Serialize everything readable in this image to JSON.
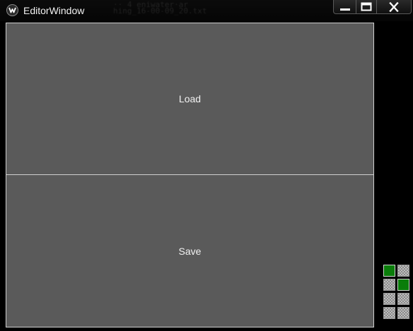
{
  "window": {
    "title": "EditorWindow",
    "background_text": "·· 4 eniwater·ar\nhing_16-00-09_20.txt"
  },
  "caption_buttons": {
    "minimize_icon": "minimize-icon",
    "maximize_icon": "maximize-icon",
    "close_icon": "close-icon"
  },
  "buttons": {
    "load_label": "Load",
    "save_label": "Save"
  },
  "grid": {
    "columns": 2,
    "rows": 4,
    "active_color": "#0a7d0a",
    "cells": [
      {
        "row": 1,
        "col": 1,
        "active": true
      },
      {
        "row": 1,
        "col": 2,
        "active": false
      },
      {
        "row": 2,
        "col": 1,
        "active": false
      },
      {
        "row": 2,
        "col": 2,
        "active": true
      },
      {
        "row": 3,
        "col": 1,
        "active": false
      },
      {
        "row": 3,
        "col": 2,
        "active": false
      },
      {
        "row": 4,
        "col": 1,
        "active": false
      },
      {
        "row": 4,
        "col": 2,
        "active": false
      }
    ]
  },
  "colors": {
    "button_bg": "#5a5a5a",
    "button_border": "#cfcfcf",
    "window_bg": "#000000",
    "text": "#f2f2f2"
  }
}
